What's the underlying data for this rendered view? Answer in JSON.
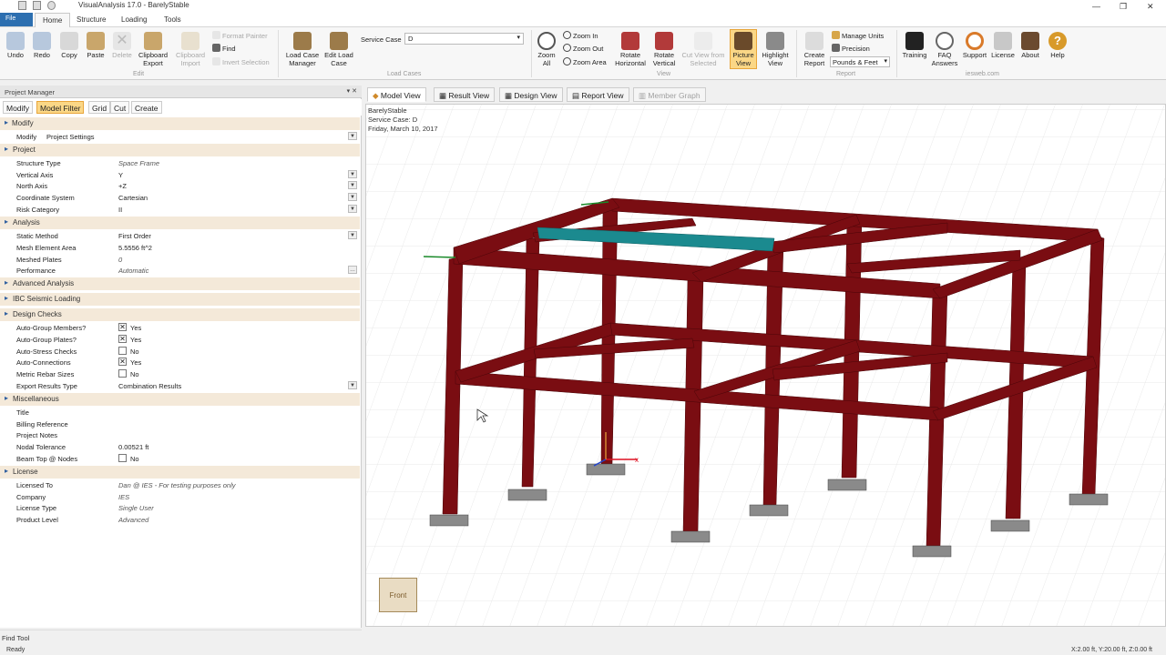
{
  "app": {
    "title": "VisualAnalysis 17.0 - BarelyStable",
    "file_label": "File"
  },
  "menu": {
    "tabs": [
      "Home",
      "Structure",
      "Loading",
      "Tools"
    ]
  },
  "ribbon": {
    "undo": "Undo",
    "redo": "Redo",
    "copy": "Copy",
    "paste": "Paste",
    "delete": "Delete",
    "clipboard_export": "Clipboard Export",
    "clipboard_import": "Clipboard Import",
    "format_painter": "Format Painter",
    "find": "Find",
    "invert_selection": "Invert Selection",
    "edit_group": "Edit",
    "load_case_manager": "Load Case Manager",
    "edit_load_case": "Edit Load Case",
    "service_case_label": "Service Case",
    "service_case_value": "D",
    "load_cases_group": "Load Cases",
    "zoom_all": "Zoom All",
    "zoom_in": "Zoom In",
    "zoom_out": "Zoom Out",
    "zoom_area": "Zoom Area",
    "rotate_horizontal": "Rotate Horizontal",
    "rotate_vertical": "Rotate Vertical",
    "cut_view_from_selected": "Cut View from Selected",
    "picture_view": "Picture View",
    "highlight_view": "Highlight View",
    "view_group": "View",
    "create_report": "Create Report",
    "manage_units": "Manage Units",
    "precision": "Precision",
    "units_value": "Pounds & Feet",
    "report_group": "Report",
    "training": "Training",
    "faq_answers": "FAQ Answers",
    "support": "Support",
    "license": "License",
    "about": "About",
    "help": "Help",
    "iesweb_group": "iesweb.com"
  },
  "panel": {
    "title": "Project Manager",
    "tabs": [
      "Modify",
      "Model Filter",
      "Grid",
      "Cut",
      "Create"
    ],
    "modify_header": "Modify",
    "modify_label": "Modify",
    "modify_value": "Project Settings",
    "sections": {
      "project": "Project",
      "analysis": "Analysis",
      "advanced": "Advanced Analysis",
      "ibc": "IBC Seismic Loading",
      "design": "Design Checks",
      "misc": "Miscellaneous",
      "license": "License"
    },
    "project_rows": [
      {
        "k": "Structure Type",
        "v": "Space Frame"
      },
      {
        "k": "Vertical Axis",
        "v": "Y"
      },
      {
        "k": "North Axis",
        "v": "+Z"
      },
      {
        "k": "Coordinate System",
        "v": "Cartesian"
      },
      {
        "k": "Risk Category",
        "v": "II"
      }
    ],
    "analysis_rows": [
      {
        "k": "Static Method",
        "v": "First Order"
      },
      {
        "k": "Mesh Element Area",
        "v": "5.5556 ft^2"
      },
      {
        "k": "Meshed Plates",
        "v": "0"
      },
      {
        "k": "Performance",
        "v": "Automatic"
      }
    ],
    "design_rows": [
      {
        "k": "Auto-Group Members?",
        "v": "Yes",
        "checked": true
      },
      {
        "k": "Auto-Group Plates?",
        "v": "Yes",
        "checked": true
      },
      {
        "k": "Auto-Stress Checks",
        "v": "No",
        "checked": false
      },
      {
        "k": "Auto-Connections",
        "v": "Yes",
        "checked": true
      },
      {
        "k": "Metric Rebar Sizes",
        "v": "No",
        "checked": false
      },
      {
        "k": "Export Results Type",
        "v": "Combination Results"
      }
    ],
    "misc_rows": [
      {
        "k": "Title",
        "v": ""
      },
      {
        "k": "Billing Reference",
        "v": ""
      },
      {
        "k": "Project Notes",
        "v": ""
      },
      {
        "k": "Nodal Tolerance",
        "v": "0.00521 ft"
      },
      {
        "k": "Beam Top @ Nodes",
        "v": "No"
      }
    ],
    "license_rows": [
      {
        "k": "Licensed To",
        "v": "Dan @ IES - For testing purposes only"
      },
      {
        "k": "Company",
        "v": "IES"
      },
      {
        "k": "License Type",
        "v": "Single User"
      },
      {
        "k": "Product Level",
        "v": "Advanced"
      }
    ]
  },
  "views": {
    "tabs": [
      "Model View",
      "Result View",
      "Design View",
      "Report View",
      "Member Graph"
    ]
  },
  "viewport": {
    "line1": "BarelyStable",
    "line2": "Service Case: D",
    "line3": "Friday, March 10, 2017",
    "cube_label": "Front",
    "axis_x": "x"
  },
  "status": {
    "find_tool": "Find Tool",
    "ready": "Ready",
    "scale": "X:2.00 ft, Y:20.00 ft, Z:0.00 ft"
  },
  "colors": {
    "member": "#7a0d12",
    "selected": "#1b8a8f",
    "accent": "#fbd786",
    "file": "#2d6fb0"
  }
}
